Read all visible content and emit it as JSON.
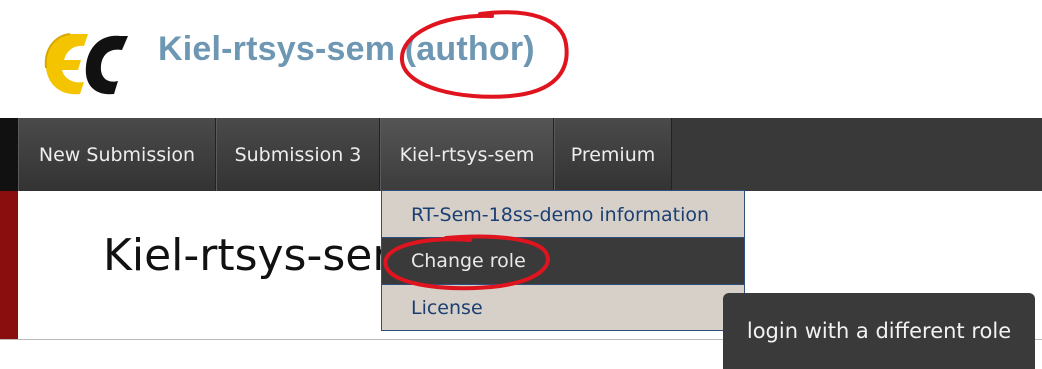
{
  "header": {
    "logo_icon": "ec-logo",
    "title": "Kiel-rtsys-sem (author)"
  },
  "navbar": {
    "items": [
      {
        "label": "New Submission"
      },
      {
        "label": "Submission 3"
      },
      {
        "label": "Kiel-rtsys-sem"
      },
      {
        "label": "Premium"
      }
    ]
  },
  "main": {
    "heading": "Kiel-rtsys-ser"
  },
  "dropdown": {
    "items": [
      {
        "label": "RT-Sem-18ss-demo information"
      },
      {
        "label": "Change role"
      },
      {
        "label": "License"
      }
    ]
  },
  "tooltip": {
    "text": "login with a different role"
  },
  "colors": {
    "title": "#6e97b3",
    "navbar": "#393939",
    "accent_red": "#8b0e0e",
    "annotation": "#e0141e"
  }
}
